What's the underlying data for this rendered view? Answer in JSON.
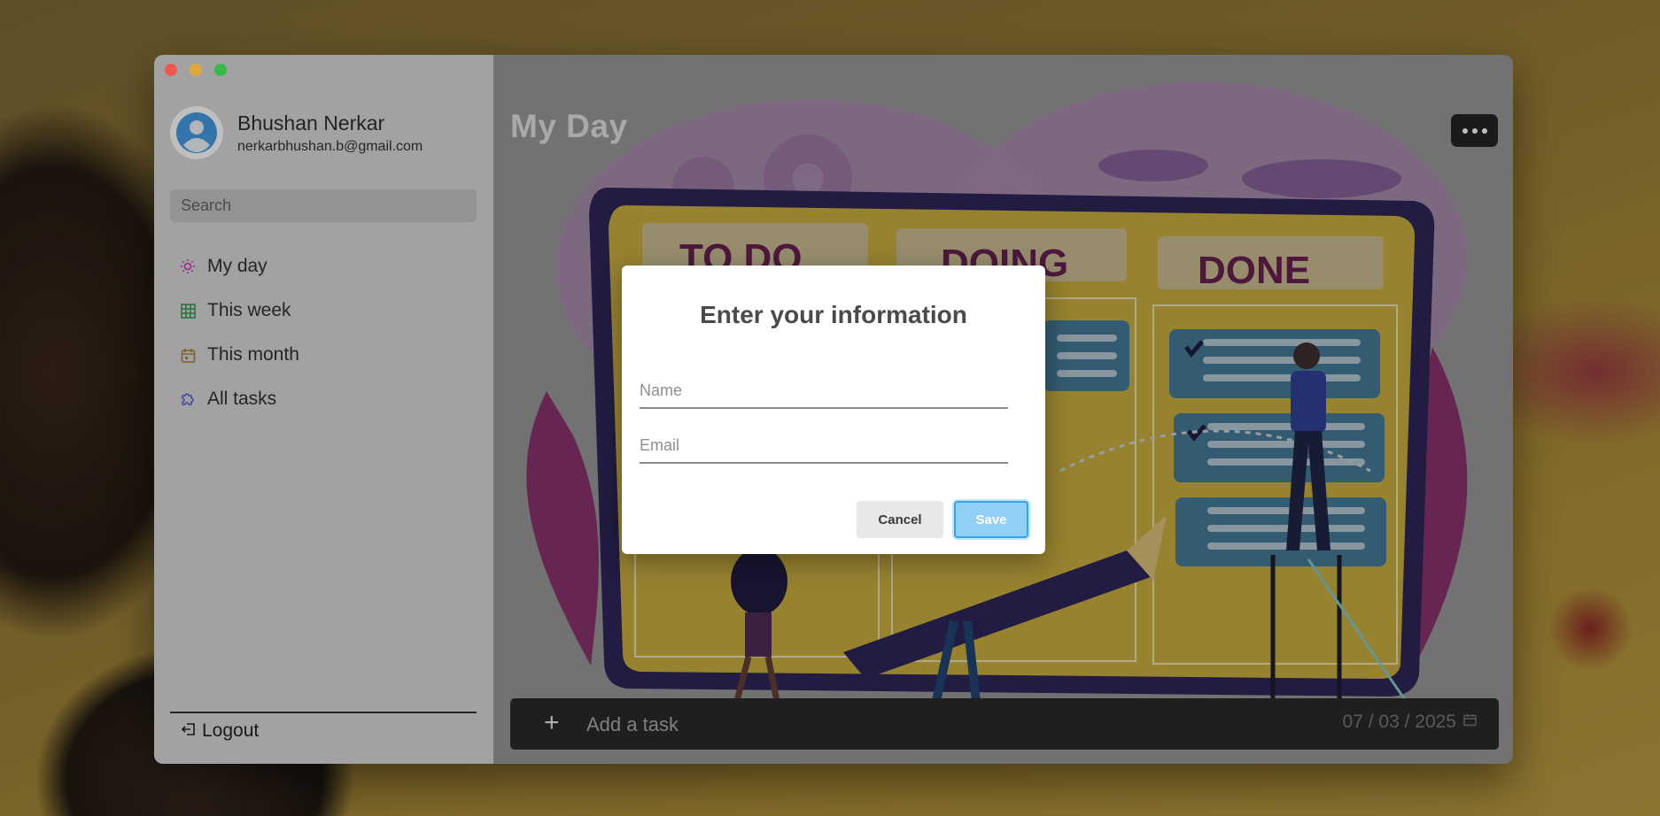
{
  "window": {
    "controls": [
      "close",
      "minimize",
      "maximize"
    ]
  },
  "sidebar": {
    "user": {
      "name": "Bhushan Nerkar",
      "email": "nerkarbhushan.b@gmail.com"
    },
    "search": {
      "placeholder": "Search",
      "value": ""
    },
    "items": [
      {
        "label": "My day",
        "icon": "sun-icon",
        "color": "#c02fa8"
      },
      {
        "label": "This week",
        "icon": "grid-icon",
        "color": "#2e8b4e"
      },
      {
        "label": "This month",
        "icon": "calendar-icon",
        "color": "#a0782a"
      },
      {
        "label": "All tasks",
        "icon": "puzzle-icon",
        "color": "#4b57c9"
      }
    ],
    "logout_label": "Logout"
  },
  "main": {
    "title": "My Day",
    "illustration": {
      "columns": [
        "TO DO",
        "DOING",
        "DONE"
      ]
    },
    "add_task": {
      "placeholder": "Add a task",
      "date": "07 / 03 / 2025"
    }
  },
  "modal": {
    "title": "Enter your information",
    "name_placeholder": "Name",
    "email_placeholder": "Email",
    "cancel_label": "Cancel",
    "save_label": "Save"
  },
  "colors": {
    "save_button": "#8fd0f4",
    "sidebar_bg": "#c6c6c6",
    "task_bar_bg": "#262626"
  }
}
